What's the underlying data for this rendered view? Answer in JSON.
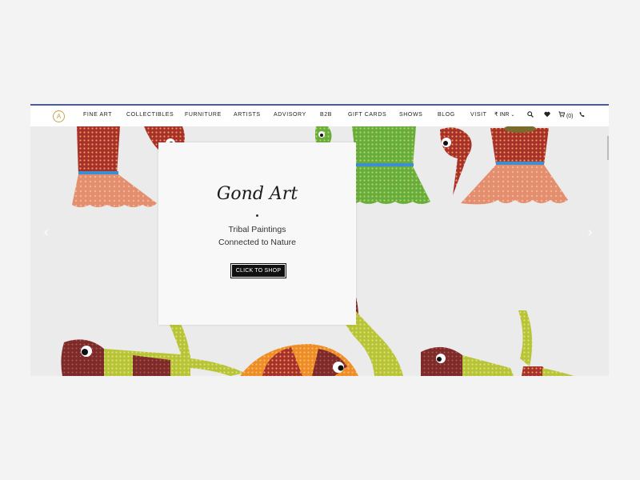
{
  "nav": {
    "logo_text": "A",
    "items": [
      "FINE ART",
      "COLLECTIBLES",
      "FURNITURE",
      "ARTISTS",
      "ADVISORY",
      "B2B",
      "GIFT CARDS",
      "SHOWS",
      "BLOG",
      "VISIT"
    ],
    "currency": "₹ INR",
    "cart_count": "(0)"
  },
  "hero": {
    "title": "Gond Art",
    "subtitle_line1": "Tribal Paintings",
    "subtitle_line2": "Connected to Nature",
    "button_label": "CLICK TO SHOP"
  },
  "icons": {
    "prev": "chevron-left-icon",
    "next": "chevron-right-icon",
    "search": "search-icon",
    "wishlist": "heart-icon",
    "cart": "cart-icon",
    "phone": "phone-icon"
  },
  "colors": {
    "nav_border": "#4a5e93",
    "logo": "#c9a14a",
    "button_bg": "#111111",
    "hero_bg": "#ebebeb"
  }
}
